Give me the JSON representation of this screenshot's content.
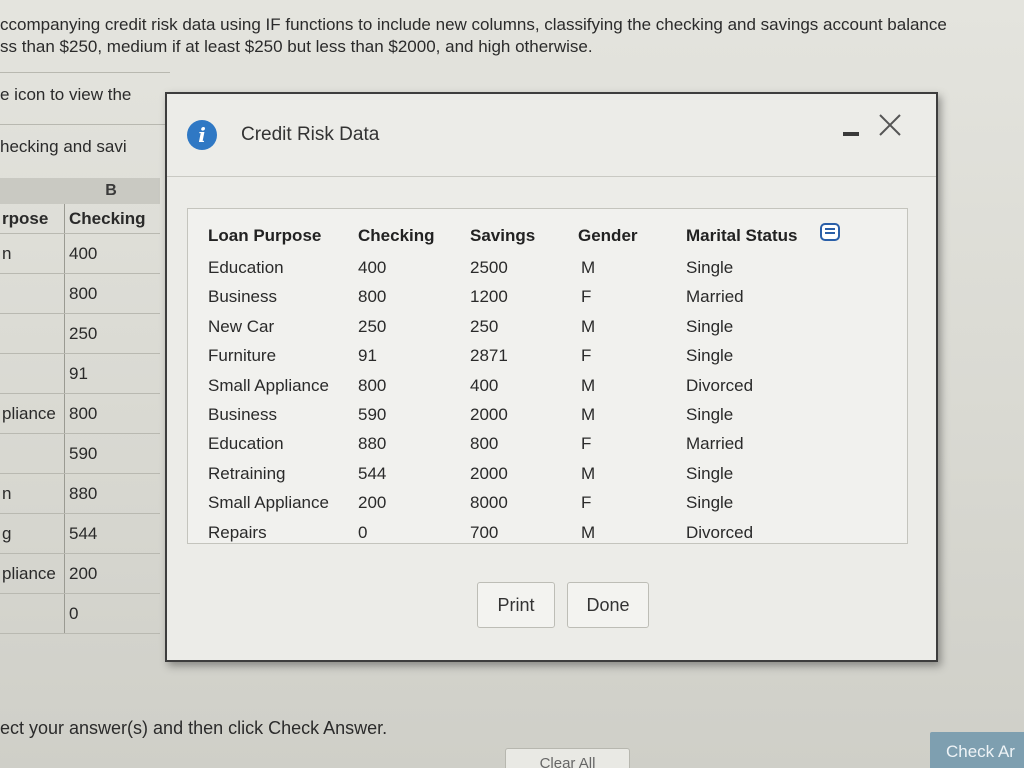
{
  "instruction": {
    "line1": "ccompanying credit risk data using IF functions to include new columns, classifying the checking and savings account balance",
    "line2": "ss than $250, medium if at least $250 but less than $2000, and high otherwise."
  },
  "hint1": "e icon to view the",
  "hint2": "hecking and savi",
  "sheet": {
    "col_b_letter": "B",
    "header": {
      "a": "rpose",
      "b": "Checking"
    },
    "rows": [
      {
        "a": "n",
        "b": "400"
      },
      {
        "a": "",
        "b": "800"
      },
      {
        "a": "",
        "b": "250"
      },
      {
        "a": "",
        "b": "91"
      },
      {
        "a": "pliance",
        "b": "800"
      },
      {
        "a": "",
        "b": "590"
      },
      {
        "a": "n",
        "b": "880"
      },
      {
        "a": "g",
        "b": "544"
      },
      {
        "a": "pliance",
        "b": "200"
      },
      {
        "a": "",
        "b": "0"
      }
    ]
  },
  "bottom": {
    "instruction": "ect your answer(s) and then click Check Answer.",
    "clear_label": "Clear All",
    "check_label": "Check Ar"
  },
  "modal": {
    "title": "Credit Risk Data",
    "info_icon": "info-icon",
    "columns": [
      "Loan Purpose",
      "Checking",
      "Savings",
      "Gender",
      "Marital Status"
    ],
    "rows": [
      {
        "purpose": "Education",
        "checking": "400",
        "savings": "2500",
        "gender": "M",
        "marital": "Single"
      },
      {
        "purpose": "Business",
        "checking": "800",
        "savings": "1200",
        "gender": "F",
        "marital": "Married"
      },
      {
        "purpose": "New Car",
        "checking": "250",
        "savings": "250",
        "gender": "M",
        "marital": "Single"
      },
      {
        "purpose": "Furniture",
        "checking": "91",
        "savings": "2871",
        "gender": "F",
        "marital": "Single"
      },
      {
        "purpose": "Small Appliance",
        "checking": "800",
        "savings": "400",
        "gender": "M",
        "marital": "Divorced"
      },
      {
        "purpose": "Business",
        "checking": "590",
        "savings": "2000",
        "gender": "M",
        "marital": "Single"
      },
      {
        "purpose": "Education",
        "checking": "880",
        "savings": "800",
        "gender": "F",
        "marital": "Married"
      },
      {
        "purpose": "Retraining",
        "checking": "544",
        "savings": "2000",
        "gender": "M",
        "marital": "Single"
      },
      {
        "purpose": "Small Appliance",
        "checking": "200",
        "savings": "8000",
        "gender": "F",
        "marital": "Single"
      },
      {
        "purpose": "Repairs",
        "checking": "0",
        "savings": "700",
        "gender": "M",
        "marital": "Divorced"
      }
    ],
    "print_label": "Print",
    "done_label": "Done"
  }
}
